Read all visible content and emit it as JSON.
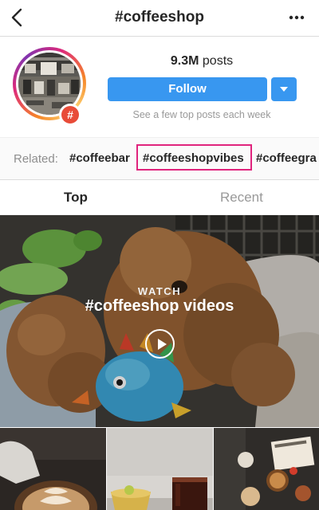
{
  "header": {
    "title": "#coffeeshop",
    "back_icon": "chevron-left-icon",
    "more_icon": "more-horizontal-icon"
  },
  "profile": {
    "posts_value": "9.3M",
    "posts_label": "posts",
    "follow_label": "Follow",
    "hint": "See a few top posts each week",
    "badge_symbol": "#",
    "accent_color": "#3897f0"
  },
  "related": {
    "label": "Related:",
    "tags": [
      "#coffeebar",
      "#coffeeshopvibes",
      "#coffeegra"
    ],
    "highlight_color": "#e0247d"
  },
  "tabs": {
    "top": "Top",
    "recent": "Recent"
  },
  "hero": {
    "watch_label": "WATCH",
    "title": "#coffeeshop videos"
  }
}
